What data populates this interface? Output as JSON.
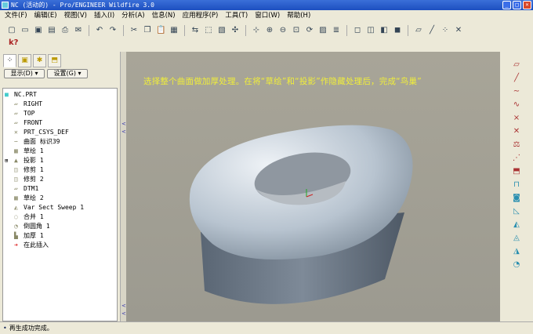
{
  "window": {
    "title": "NC (活动的) - Pro/ENGINEER Wildfire 3.0"
  },
  "menu": [
    "文件(F)",
    "编辑(E)",
    "视图(V)",
    "插入(I)",
    "分析(A)",
    "信息(N)",
    "应用程序(P)",
    "工具(T)",
    "窗口(W)",
    "帮助(H)"
  ],
  "toolbar_icons": [
    "new",
    "open",
    "save",
    "save-copy",
    "print",
    "email",
    "undo",
    "redo",
    "cut",
    "copy",
    "paste",
    "paste-special",
    "regenerate",
    "select-box",
    "repaint",
    "spin-center",
    "orient",
    "zoom-in",
    "zoom-out",
    "refit",
    "reorient",
    "saved-views",
    "layers",
    "wireframe",
    "hidden-line",
    "no-hidden",
    "shaded",
    "datum-planes",
    "datum-axes",
    "datum-points",
    "coord-sys"
  ],
  "context_help": "k?",
  "navigator": {
    "tabs": [
      "model-tree",
      "folder-browser",
      "favorites",
      "connections"
    ],
    "show_button": "显示(D) ▾",
    "settings_button": "设置(G) ▾",
    "tree": [
      {
        "label": "NC.PRT",
        "icon": "■"
      },
      {
        "label": "RIGHT",
        "icon": "▱"
      },
      {
        "label": "TOP",
        "icon": "▱"
      },
      {
        "label": "FRONT",
        "icon": "▱"
      },
      {
        "label": "PRT_CSYS_DEF",
        "icon": "✕"
      },
      {
        "label": "曲面 标识39",
        "icon": "∽"
      },
      {
        "label": "草绘 1",
        "icon": "▦"
      },
      {
        "label": "投影 1",
        "icon": "▲",
        "expand": "⊞"
      },
      {
        "label": "修剪 1",
        "icon": "◫"
      },
      {
        "label": "修剪 2",
        "icon": "◫"
      },
      {
        "label": "DTM1",
        "icon": "▱"
      },
      {
        "label": "草绘 2",
        "icon": "▦"
      },
      {
        "label": "Var Sect Sweep 1",
        "icon": "◭"
      },
      {
        "label": "合并 1",
        "icon": "◌"
      },
      {
        "label": "倒圆角 1",
        "icon": "◔"
      },
      {
        "label": "加厚 1",
        "icon": "▙"
      },
      {
        "label": "在此插入",
        "icon": "➜"
      }
    ]
  },
  "viewport": {
    "instruction": "选择整个曲面做加厚处理。在将“草绘”和“投影”作隐藏处理后，完成“鸟巢”"
  },
  "right_toolbar": [
    "datum-plane",
    "datum-axis",
    "datum-curve",
    "sketch",
    "datum-point",
    "coord-sys",
    "analysis",
    "datum-more",
    "insert-style",
    "extrude",
    "revolve",
    "sweep",
    "blend",
    "offset",
    "variable-sweep",
    "round"
  ],
  "status": {
    "message": "再生成功完成。"
  }
}
